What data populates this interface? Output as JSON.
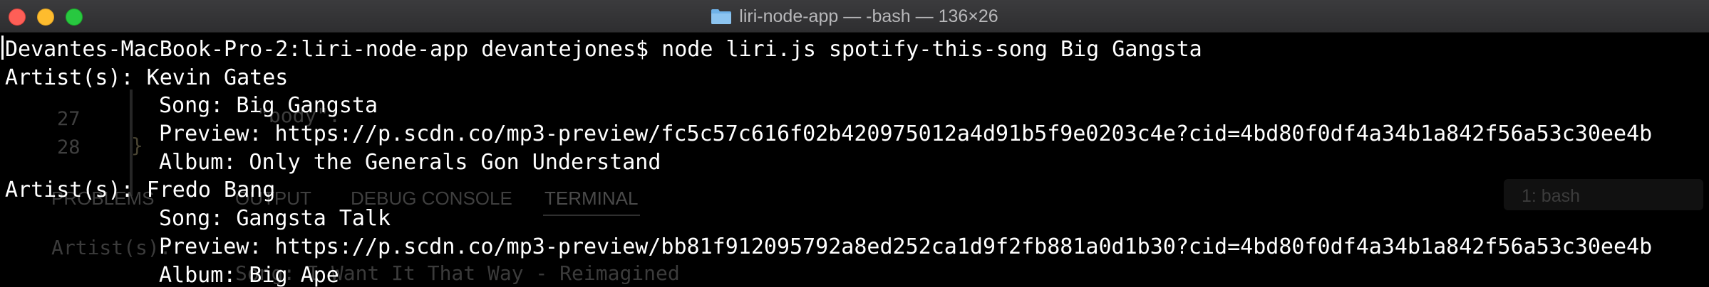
{
  "window": {
    "title": "liri-node-app — -bash — 136×26",
    "folder_icon": "folder-icon",
    "buttons": {
      "close": "close-button",
      "minimize": "minimize-button",
      "zoom": "zoom-button"
    }
  },
  "terminal": {
    "prompt": "Devantes-MacBook-Pro-2:liri-node-app devantejones$ node liri.js spotify-this-song Big Gangsta",
    "results": [
      {
        "artist": "Artist(s): Kevin Gates",
        "song": "Song: Big Gangsta",
        "preview": "Preview: https://p.scdn.co/mp3-preview/fc5c57c616f02b420975012a4d91b5f9e0203c4e?cid=4bd80f0df4a34b1a842f56a53c30ee4b",
        "album": "Album: Only the Generals Gon Understand"
      },
      {
        "artist": "Artist(s): Fredo Bang",
        "song": "Song: Gangsta Talk",
        "preview": "Preview: https://p.scdn.co/mp3-preview/bb81f912095792a8ed252ca1d9f2fb881a0d1b30?cid=4bd80f0df4a34b1a842f56a53c30ee4b",
        "album": "Album: Big Ape"
      }
    ]
  },
  "background_editor": {
    "code_fragment": "\"body\":",
    "line_numbers": [
      "27",
      "28"
    ],
    "closing_brace": "}",
    "panel_tabs": [
      "PROBLEMS",
      "OUTPUT",
      "DEBUG CONSOLE",
      "TERMINAL"
    ],
    "terminal_select": "1: bash",
    "ghost_terminal_line_1": "Artist(s): ",
    "ghost_terminal_line_2": "Song: I Want It That Way - Reimagined"
  },
  "colors": {
    "background": "#000000",
    "text": "#ffffff",
    "titlebar": "#323234",
    "close": "#fe5f57",
    "minimize": "#febc2e",
    "zoom": "#28c840"
  }
}
